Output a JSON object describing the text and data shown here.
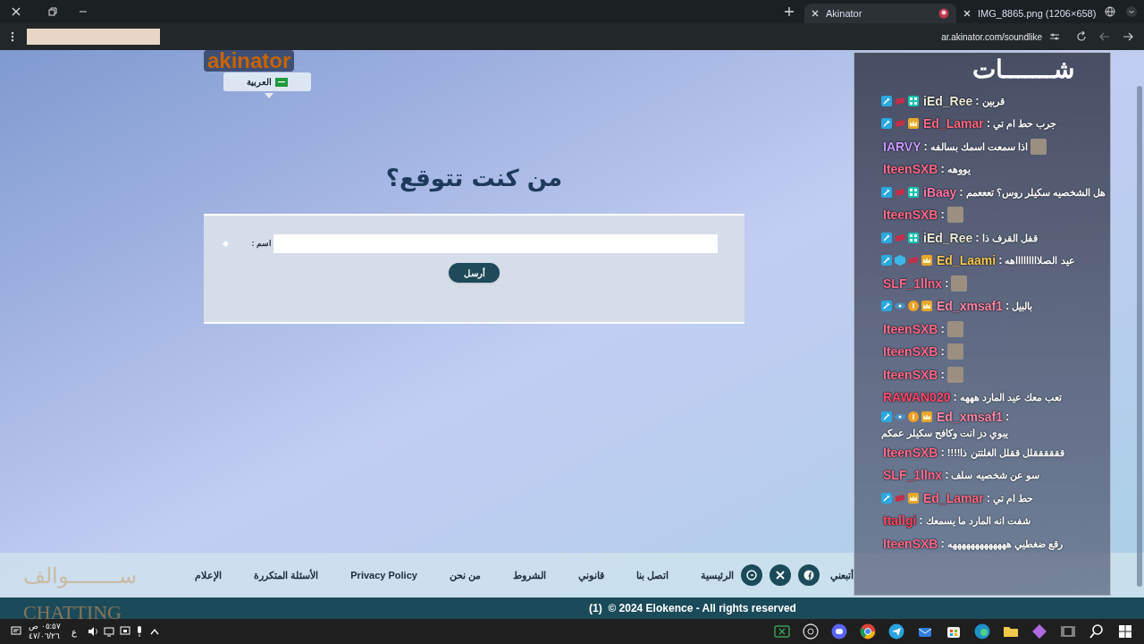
{
  "browser": {
    "tabs": [
      {
        "title": "IMG_8865.png (1206×658)",
        "selected": false
      },
      {
        "title": "Akinator",
        "selected": true
      }
    ],
    "url": "ar.akinator.com/soundlike"
  },
  "page": {
    "logo": "akinator",
    "language": "العربية",
    "title": "من كنت تتوقع؟",
    "form": {
      "label": "اسم :",
      "submit": "أرسل"
    },
    "footer": {
      "follow": "أتبعني",
      "social": [
        {
          "kind": "facebook"
        },
        {
          "kind": "x"
        },
        {
          "kind": "gplus"
        }
      ],
      "links": [
        "الرئيسية",
        "اتصل بنا",
        "قانوني",
        "الشروط",
        "من نحن",
        "Privacy Policy",
        "الأسئلة المتكررة",
        "الإعلام"
      ]
    },
    "copyright": "(1)  © 2024 Elokence - All rights reserved"
  },
  "overlay": {
    "logo": "ســــــــوالف",
    "logo_sub": "CHATTING"
  },
  "chat": {
    "title": "شـــــــات",
    "separator": ":",
    "messages": [
      {
        "user": "iEd_Ree",
        "color": "#ecead8",
        "badges": [
          {
            "kind": "wrench"
          },
          {
            "kind": "flag"
          },
          {
            "kind": "grid"
          }
        ],
        "text": "قربين"
      },
      {
        "user": "Ed_Lamar",
        "color": "#ff6a84",
        "badges": [
          {
            "kind": "wrench"
          },
          {
            "kind": "flag"
          },
          {
            "kind": "crown"
          }
        ],
        "text": "جرب حط ام تي"
      },
      {
        "user": "IARVY",
        "color": "#c898ff",
        "text": "اذا سمعت اسمك بسالفه",
        "sticker": true
      },
      {
        "user": "IteenSXB",
        "color": "#ff6a8a",
        "text": "يووهه"
      },
      {
        "user": "iBaay",
        "color": "#ff7aa8",
        "badges": [
          {
            "kind": "wrench"
          },
          {
            "kind": "flag"
          },
          {
            "kind": "grid"
          }
        ],
        "text": "هل الشخصيه سكيلر روس؟ تعععمم"
      },
      {
        "user": "IteenSXB",
        "color": "#ff6a8a",
        "sticker": true
      },
      {
        "user": "iEd_Ree",
        "color": "#ecead8",
        "badges": [
          {
            "kind": "wrench"
          },
          {
            "kind": "flag"
          },
          {
            "kind": "grid"
          }
        ],
        "text": "قفل القرف ذا"
      },
      {
        "user": "Ed_Laami",
        "color": "#f8c850",
        "badges": [
          {
            "kind": "wrench"
          },
          {
            "kind": "cube"
          },
          {
            "kind": "flag"
          },
          {
            "kind": "crown"
          }
        ],
        "text": "عيد الصلاااااااااهه"
      },
      {
        "user": "SLF_1llnx",
        "color": "#ff6a8a",
        "sticker": true
      },
      {
        "user": "Ed_xmsaf1",
        "color": "#ff88a8",
        "badges": [
          {
            "kind": "wrench"
          },
          {
            "kind": "eye"
          },
          {
            "kind": "coin"
          },
          {
            "kind": "crown"
          }
        ],
        "text": "بالبيل"
      },
      {
        "user": "IteenSXB",
        "color": "#ff6a8a",
        "sticker": true
      },
      {
        "user": "IteenSXB",
        "color": "#ff6a8a",
        "sticker": true
      },
      {
        "user": "IteenSXB",
        "color": "#ff6a8a",
        "sticker": true
      },
      {
        "user": "RAWAN020",
        "color": "#ff4a6e",
        "text": "تعب معك عيد المارد هههه"
      },
      {
        "user": "Ed_xmsaf1",
        "color": "#ff88a8",
        "badges": [
          {
            "kind": "wrench"
          },
          {
            "kind": "eye"
          },
          {
            "kind": "coin"
          },
          {
            "kind": "crown"
          }
        ],
        "text": "يبوي دز انت وكافح سكيلر عمكم"
      },
      {
        "user": "IteenSXB",
        "color": "#ff6a8a",
        "text": "ققققققلل ققلل الغلتتن ذا!!!!"
      },
      {
        "user": "SLF_1llnx",
        "color": "#ff6a8a",
        "text": "سو عن شخصيه سلف"
      },
      {
        "user": "Ed_Lamar",
        "color": "#ff6a84",
        "badges": [
          {
            "kind": "wrench"
          },
          {
            "kind": "flag"
          },
          {
            "kind": "crown"
          }
        ],
        "text": "حط ام تي"
      },
      {
        "user": "ttallgi",
        "color": "#ff4660",
        "text": "شفت انه المارد ما يسمعك"
      },
      {
        "user": "IteenSXB",
        "color": "#ff6a8a",
        "text": "رقع ضغطيي هههههههههههههه"
      }
    ]
  },
  "taskbar": {
    "time": "٠٥:٥٧ ص",
    "date": "٤٧/٠٦/٢٦",
    "language": "ع"
  }
}
